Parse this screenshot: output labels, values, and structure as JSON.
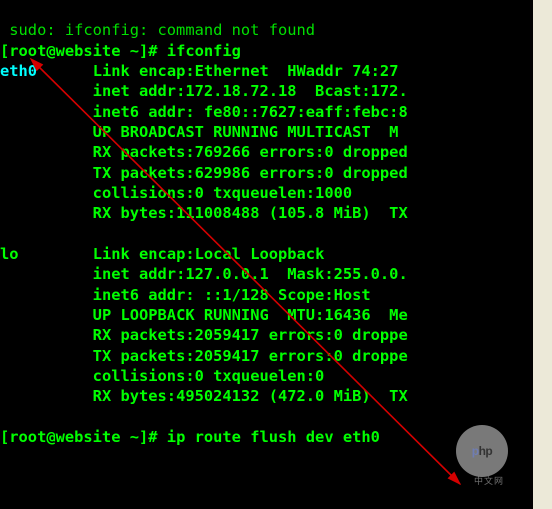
{
  "header": {
    "partial_top": " sudo: ifconfig: command not found",
    "prompt1": "[root@website ~]# ",
    "cmd1": "ifconfig"
  },
  "eth0": {
    "name": "eth0",
    "l1a": "Link encap:Ethernet  HWaddr 74:27",
    "l2": "inet addr:172.18.72.18  Bcast:172.",
    "l3": "inet6 addr: fe80::7627:eaff:febc:8",
    "l4": "UP BROADCAST RUNNING MULTICAST  M",
    "l5": "RX packets:769266 errors:0 dropped",
    "l6": "TX packets:629986 errors:0 dropped",
    "l7": "collisions:0 txqueuelen:1000",
    "l8": "RX bytes:111008488 (105.8 MiB)  TX"
  },
  "lo": {
    "name": "lo",
    "l1": "Link encap:Local Loopback",
    "l2": "inet addr:127.0.0.1  Mask:255.0.0.",
    "l3": "inet6 addr: ::1/128 Scope:Host",
    "l4": "UP LOOPBACK RUNNING  MTU:16436  Me",
    "l5": "RX packets:2059417 errors:0 droppe",
    "l6": "TX packets:2059417 errors:0 droppe",
    "l7": "collisions:0 txqueuelen:0",
    "l8": "RX bytes:495024132 (472.0 MiB)  TX"
  },
  "footer": {
    "prompt2": "[root@website ~]# ",
    "cmd2": "ip route flush dev eth0"
  },
  "watermark": {
    "logo_a": "p",
    "logo_b": "hp",
    "sub": "中文网"
  }
}
